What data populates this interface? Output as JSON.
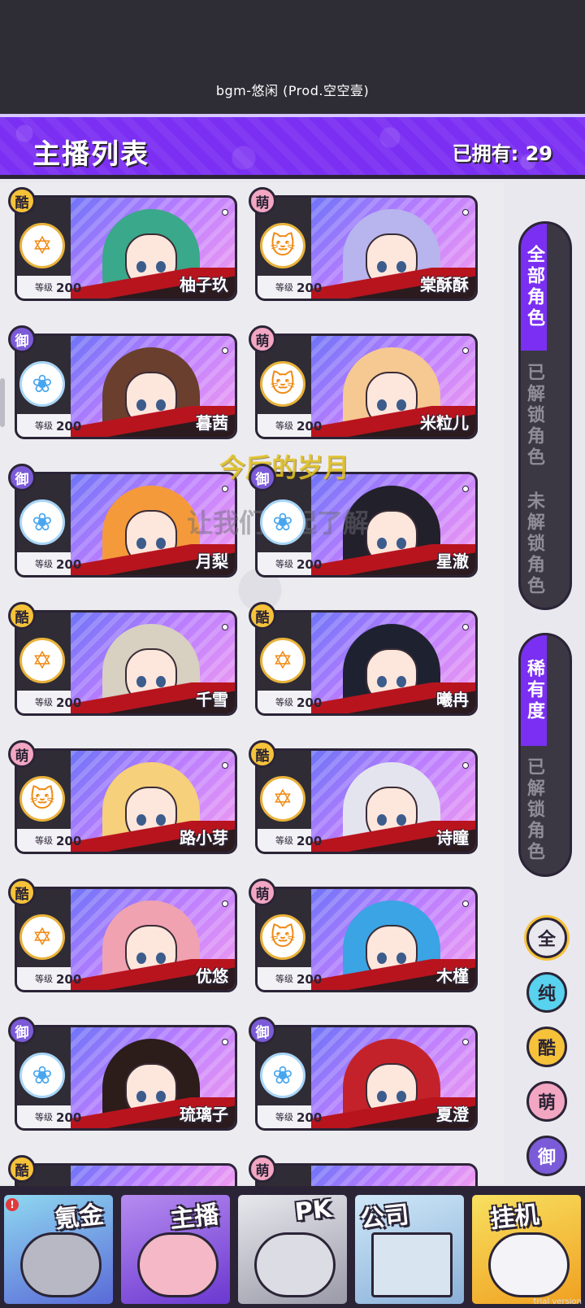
{
  "top_bar": {
    "bgm": "bgm-悠闲 (Prod.空空壹)"
  },
  "header": {
    "title": "主播列表",
    "owned": "已拥有: 29"
  },
  "cards": [
    {
      "name": "柚子玖",
      "type": "酷",
      "type_key": "cool",
      "level_label": "等级",
      "level": "200",
      "attr_icon": "star-icon",
      "hair": "#3aa88a"
    },
    {
      "name": "棠酥酥",
      "type": "萌",
      "type_key": "cute",
      "level_label": "等级",
      "level": "200",
      "attr_icon": "cat-icon",
      "hair": "#b7b4ee"
    },
    {
      "name": "暮茜",
      "type": "御",
      "type_key": "royal",
      "level_label": "等级",
      "level": "200",
      "attr_icon": "rose-icon",
      "hair": "#6a3f2e"
    },
    {
      "name": "米粒儿",
      "type": "萌",
      "type_key": "cute",
      "level_label": "等级",
      "level": "200",
      "attr_icon": "cat-icon",
      "hair": "#f6c892"
    },
    {
      "name": "月梨",
      "type": "御",
      "type_key": "royal",
      "level_label": "等级",
      "level": "200",
      "attr_icon": "rose-icon",
      "hair": "#f59a3a"
    },
    {
      "name": "星澈",
      "type": "御",
      "type_key": "royal",
      "level_label": "等级",
      "level": "200",
      "attr_icon": "rose-icon",
      "hair": "#22202a"
    },
    {
      "name": "千雪",
      "type": "酷",
      "type_key": "cool",
      "level_label": "等级",
      "level": "200",
      "attr_icon": "star-icon",
      "hair": "#d8d0c0"
    },
    {
      "name": "曦冉",
      "type": "酷",
      "type_key": "cool",
      "level_label": "等级",
      "level": "200",
      "attr_icon": "star-icon",
      "hair": "#1e2230"
    },
    {
      "name": "路小芽",
      "type": "萌",
      "type_key": "cute",
      "level_label": "等级",
      "level": "200",
      "attr_icon": "cat-icon",
      "hair": "#f6d07a"
    },
    {
      "name": "诗瞳",
      "type": "酷",
      "type_key": "cool",
      "level_label": "等级",
      "level": "200",
      "attr_icon": "star-icon",
      "hair": "#e4e4ee"
    },
    {
      "name": "优悠",
      "type": "酷",
      "type_key": "cool",
      "level_label": "等级",
      "level": "200",
      "attr_icon": "star-icon",
      "hair": "#f0a2b0"
    },
    {
      "name": "木槿",
      "type": "萌",
      "type_key": "cute",
      "level_label": "等级",
      "level": "200",
      "attr_icon": "cat-icon",
      "hair": "#3aa4e4"
    },
    {
      "name": "琉璃子",
      "type": "御",
      "type_key": "royal",
      "level_label": "等级",
      "level": "200",
      "attr_icon": "rose-icon",
      "hair": "#2c1c1a"
    },
    {
      "name": "夏澄",
      "type": "御",
      "type_key": "royal",
      "level_label": "等级",
      "level": "200",
      "attr_icon": "rose-icon",
      "hair": "#c4222a"
    }
  ],
  "partial_cards": [
    {
      "type": "酷",
      "type_key": "cool"
    },
    {
      "type": "萌",
      "type_key": "cute"
    }
  ],
  "filters": {
    "category": [
      {
        "label": "全部角色",
        "active": true
      },
      {
        "label": "已解锁角色",
        "active": false
      },
      {
        "label": "未解锁角色",
        "active": false
      }
    ],
    "rarity": [
      {
        "label": "稀有度",
        "active": true
      },
      {
        "label": "已解锁角色",
        "active": false
      }
    ],
    "types": [
      "全",
      "纯",
      "酷",
      "萌",
      "御"
    ]
  },
  "lyrics": {
    "line1": "今后的岁月",
    "line2": "让我们一起了解"
  },
  "bottom_nav": [
    {
      "label": "氪金",
      "alert": "!"
    },
    {
      "label": "主播"
    },
    {
      "label": "PK"
    },
    {
      "label": "公司"
    },
    {
      "label": "挂机"
    }
  ],
  "watermark": "trial version",
  "colors": {
    "accent": "#7b2ff2",
    "cool": "#f6c23a",
    "cute": "#f2a6c2",
    "royal": "#7b5bd8",
    "pure": "#58d2ee"
  }
}
